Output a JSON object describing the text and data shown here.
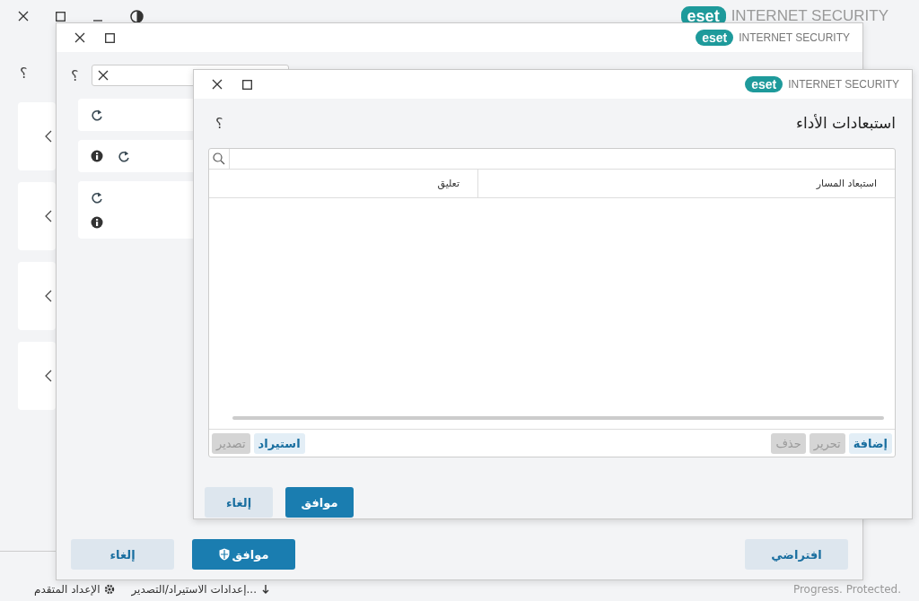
{
  "app_window": {
    "logo": "eset",
    "product": "INTERNET SECURITY",
    "help": "؟",
    "panels": [
      {
        "expanded": false
      },
      {
        "expanded": false
      },
      {
        "expanded": false
      },
      {
        "expanded": false
      }
    ],
    "footer_links": [
      "إعدادات الاستيراد/التصدير...",
      "الإعداد المتقدم"
    ],
    "status_text": "Progress. Protected."
  },
  "settings_window": {
    "logo": "eset",
    "product": "INTERNET SECURITY",
    "help": "؟",
    "cards": [
      {
        "kind": "reset"
      },
      {
        "kind": "info_reset"
      },
      {
        "kind": "reset_info"
      }
    ],
    "buttons": [
      {
        "label": "افتراضي",
        "kind": "secondary"
      },
      {
        "label": "موافق",
        "kind": "admin"
      },
      {
        "label": "إلغاء",
        "kind": "secondary"
      }
    ]
  },
  "dialog": {
    "logo": "eset",
    "product": "INTERNET SECURITY",
    "title": "استبعادات الأداء",
    "help": "؟",
    "columns": [
      "استبعاد المسار",
      "تعليق"
    ],
    "toolbar_right": [
      {
        "label": "إضافة",
        "disabled": false
      },
      {
        "label": "تحرير",
        "disabled": true
      },
      {
        "label": "حذف",
        "disabled": true
      }
    ],
    "toolbar_left": [
      {
        "label": "استيراد",
        "disabled": false
      },
      {
        "label": "تصدير",
        "disabled": true
      }
    ],
    "buttons": [
      {
        "label": "موافق",
        "kind": "primary"
      },
      {
        "label": "إلغاء",
        "kind": "secondary"
      }
    ]
  }
}
